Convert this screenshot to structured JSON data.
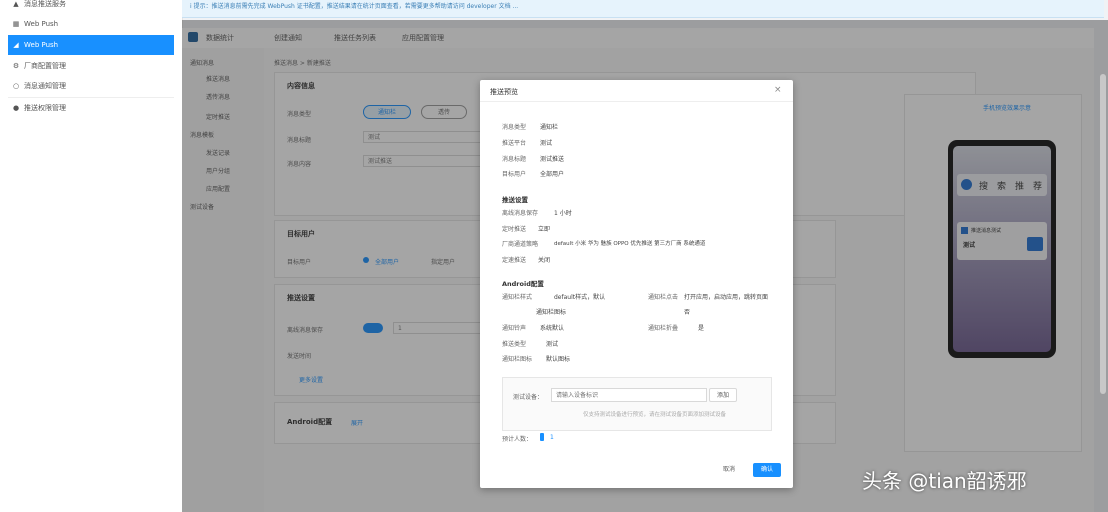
{
  "colors": {
    "accent": "#1890ff",
    "sidebar_active_text": "#ffffff",
    "tip_bg": "#e6f3fc",
    "overlay": "rgba(40,40,40,0.42)"
  },
  "sidebar": {
    "items": [
      {
        "icon": "bell-icon",
        "label": "消息推送服务",
        "active": false
      },
      {
        "icon": "grid-icon",
        "label": "Web Push",
        "active": false
      },
      {
        "icon": "send-icon",
        "label": "Web Push",
        "active": true
      },
      {
        "icon": "gear-icon",
        "label": "厂商配置管理",
        "active": false
      },
      {
        "icon": "circle-icon",
        "label": "消息通知管理",
        "active": false
      },
      {
        "icon": "user-icon",
        "label": "推送权限管理",
        "active": false
      }
    ]
  },
  "tipbar": {
    "text": "i 提示：推送消息前需先完成 WebPush 证书配置，推送结果请在统计页面查看，若需要更多帮助请访问 developer 文档 ..."
  },
  "tabs": [
    {
      "label": "数据统计"
    },
    {
      "label": "创建通知"
    },
    {
      "label": "推送任务列表"
    },
    {
      "label": "应用配置管理"
    }
  ],
  "subnav": {
    "items": [
      "通知消息",
      "推送消息",
      "透传消息",
      "定时推送",
      "消息模板",
      "发送记录",
      "用户分组",
      "应用配置",
      "测试设备"
    ]
  },
  "content": {
    "breadcrumb": "推送消息 > 新建推送",
    "section_basic": "内容信息",
    "label_type": "消息类型",
    "type_option_1": "通知栏",
    "type_option_2": "透传",
    "label_title": "消息标题",
    "title_value": "测试",
    "label_body": "消息内容",
    "body_value": "测试推送",
    "section_target": "目标用户",
    "label_target": "目标用户",
    "target_option_1": "全部用户",
    "target_option_2": "指定用户",
    "section_push": "推送设置",
    "label_offline": "离线消息保存",
    "offline_value": "1",
    "label_time": "发送时间",
    "label_more": "更多设置",
    "section_android": "Android配置",
    "android_link": "展开",
    "preview_tag": "手机预览效果示意"
  },
  "phone": {
    "search_chars": [
      "搜",
      "索",
      "推",
      "荐"
    ],
    "notif_title": "推送消息测试",
    "notif_body": "测试"
  },
  "modal": {
    "title": "推送预览",
    "close": "×",
    "rows_basic": [
      {
        "label": "消息类型",
        "value": "通知栏"
      },
      {
        "label": "推送平台",
        "value": "测试"
      },
      {
        "label": "消息标题",
        "value": "测试推送"
      },
      {
        "label": "目标用户",
        "value": "全部用户"
      }
    ],
    "section_push": "推送设置",
    "rows_push": [
      {
        "label": "离线消息保存",
        "value": "1 小时"
      },
      {
        "label": "定时推送",
        "value": "立即"
      },
      {
        "label": "厂商通道策略",
        "value": "default  小米 华为 魅族 OPPO 优先推送 第三方厂商 系统通道"
      },
      {
        "label": "定速推送",
        "value": "关闭"
      }
    ],
    "section_android": "Android配置",
    "rows_android": [
      {
        "label": "通知栏样式",
        "value": "default样式，默认",
        "label2": "通知栏点击",
        "value2": "打开应用，启动应用，跳转页面"
      },
      {
        "label": "",
        "value": "通知栏图标",
        "label2": "",
        "value2": "否"
      },
      {
        "label": "通知铃声",
        "value": "系统默认",
        "label2": "通知栏折叠",
        "value2": "是"
      },
      {
        "label": "推送类型",
        "value": "测试"
      },
      {
        "label": "通知栏图标",
        "value": "默认图标"
      }
    ],
    "test_label": "测试设备：",
    "test_placeholder": "请输入设备标识",
    "test_button": "添加",
    "test_hint": "仅支持测试设备进行预览，请在测试设备页面添加测试设备",
    "count_label": "预计人数：",
    "count_value": "1",
    "cancel": "取消",
    "confirm": "确认"
  },
  "watermark": "头条 @tian韶诱邪"
}
